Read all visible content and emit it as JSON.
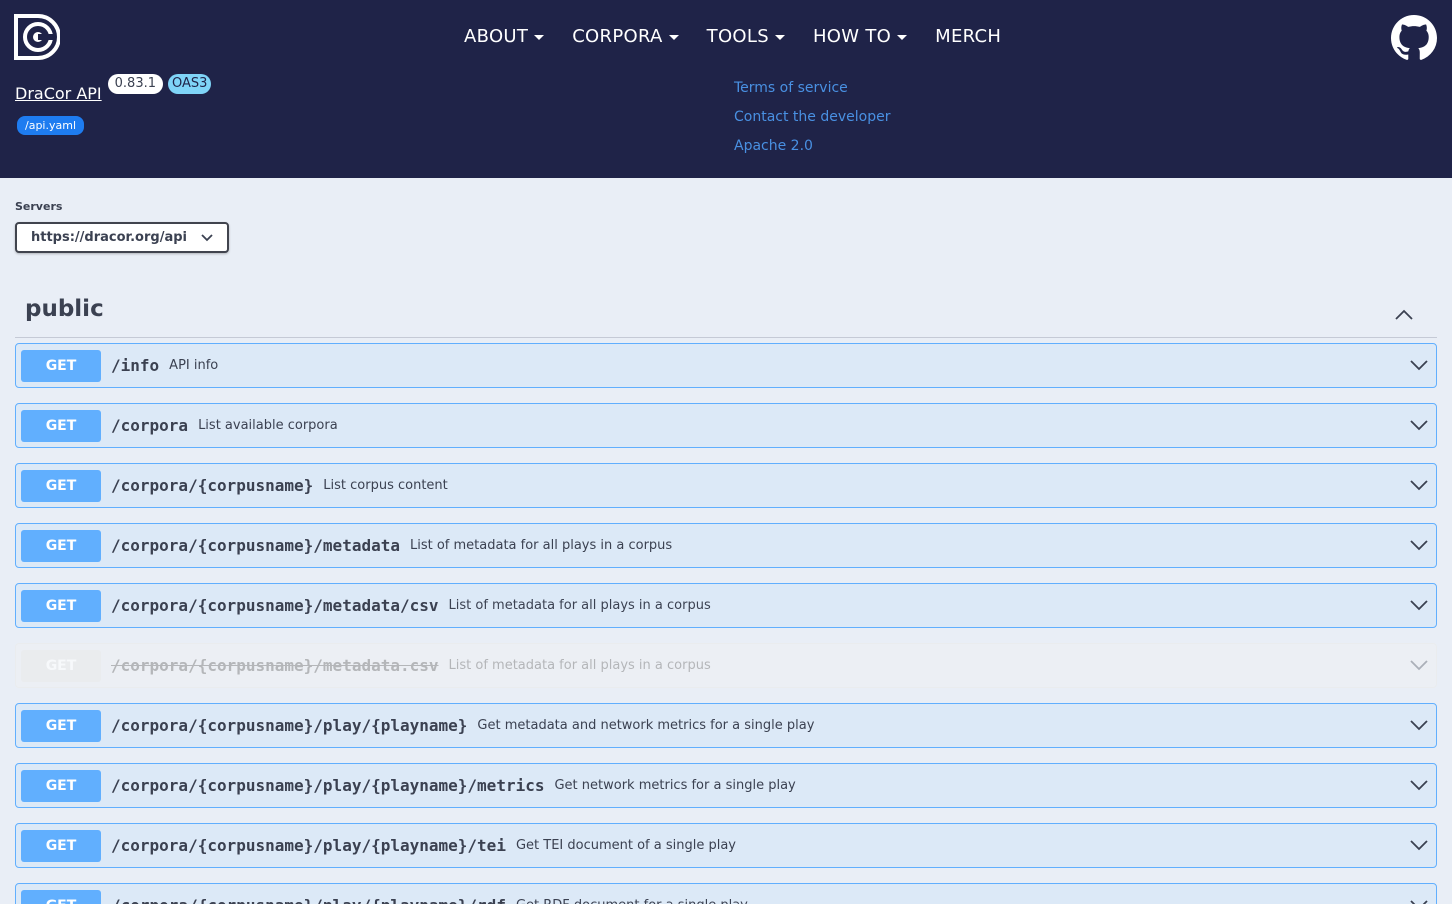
{
  "nav": {
    "items": [
      {
        "label": "ABOUT",
        "dropdown": true
      },
      {
        "label": "CORPORA",
        "dropdown": true
      },
      {
        "label": "TOOLS",
        "dropdown": true
      },
      {
        "label": "HOW TO",
        "dropdown": true
      },
      {
        "label": "MERCH",
        "dropdown": false
      }
    ]
  },
  "api": {
    "title": "DraCor API",
    "version": "0.83.1",
    "oas": "OAS3",
    "spec_link": "/api.yaml"
  },
  "info_links": {
    "terms": "Terms of service",
    "contact": "Contact the developer",
    "license": "Apache 2.0"
  },
  "servers": {
    "label": "Servers",
    "selected": "https://dracor.org/api"
  },
  "section": {
    "title": "public"
  },
  "operations": [
    {
      "method": "GET",
      "path": "/info",
      "summary": "API info",
      "deprecated": false
    },
    {
      "method": "GET",
      "path": "/corpora",
      "summary": "List available corpora",
      "deprecated": false
    },
    {
      "method": "GET",
      "path": "/corpora/{corpusname}",
      "summary": "List corpus content",
      "deprecated": false
    },
    {
      "method": "GET",
      "path": "/corpora/{corpusname}/metadata",
      "summary": "List of metadata for all plays in a corpus",
      "deprecated": false
    },
    {
      "method": "GET",
      "path": "/corpora/{corpusname}/metadata/csv",
      "summary": "List of metadata for all plays in a corpus",
      "deprecated": false
    },
    {
      "method": "GET",
      "path": "/corpora/{corpusname}/metadata.csv",
      "summary": "List of metadata for all plays in a corpus",
      "deprecated": true
    },
    {
      "method": "GET",
      "path": "/corpora/{corpusname}/play/{playname}",
      "summary": "Get metadata and network metrics for a single play",
      "deprecated": false
    },
    {
      "method": "GET",
      "path": "/corpora/{corpusname}/play/{playname}/metrics",
      "summary": "Get network metrics for a single play",
      "deprecated": false
    },
    {
      "method": "GET",
      "path": "/corpora/{corpusname}/play/{playname}/tei",
      "summary": "Get TEI document of a single play",
      "deprecated": false
    },
    {
      "method": "GET",
      "path": "/corpora/{corpusname}/play/{playname}/rdf",
      "summary": "Get RDF document for a single play",
      "deprecated": false
    }
  ],
  "colors": {
    "topbar": "#1f2348",
    "get": "#61affe",
    "link": "#4990e2",
    "badge_oas": "#7fd4f8",
    "spec_link": "#1e7cf0"
  }
}
